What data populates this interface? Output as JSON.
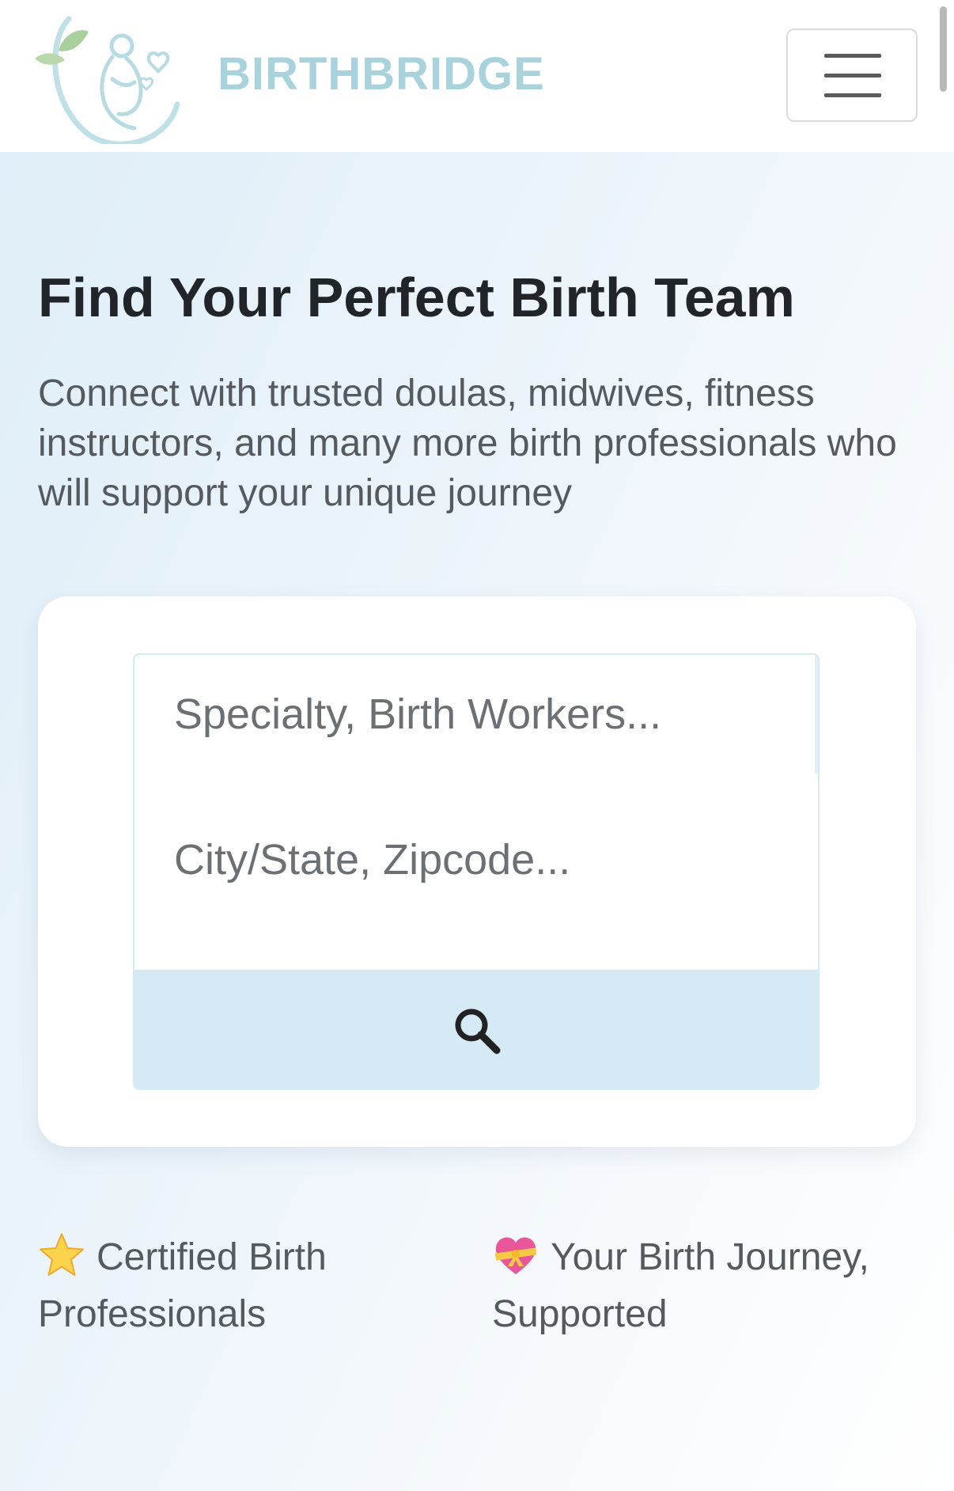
{
  "header": {
    "brand": "BIRTHBRIDGE",
    "logo_icon": "mother-baby-logo-icon",
    "menu_icon": "hamburger-menu-icon"
  },
  "hero": {
    "title": "Find Your Perfect Birth Team",
    "subtitle": "Connect with trusted doulas, midwives, fitness instructors, and many more birth professionals who will support your unique journey"
  },
  "search": {
    "specialty_placeholder": "Specialty, Birth Workers...",
    "specialty_value": "",
    "location_placeholder": "City/State, Zipcode...",
    "location_value": "",
    "button_icon": "search-icon"
  },
  "features": [
    {
      "icon": "star-icon",
      "label": "Certified Birth Professionals"
    },
    {
      "icon": "heart-ribbon-icon",
      "label": "Your Birth Journey, Supported"
    }
  ],
  "colors": {
    "brand": "#a9d3dc",
    "accent_light_blue": "#d6eaf5",
    "title_text": "#212529",
    "body_text": "#555a5f"
  }
}
